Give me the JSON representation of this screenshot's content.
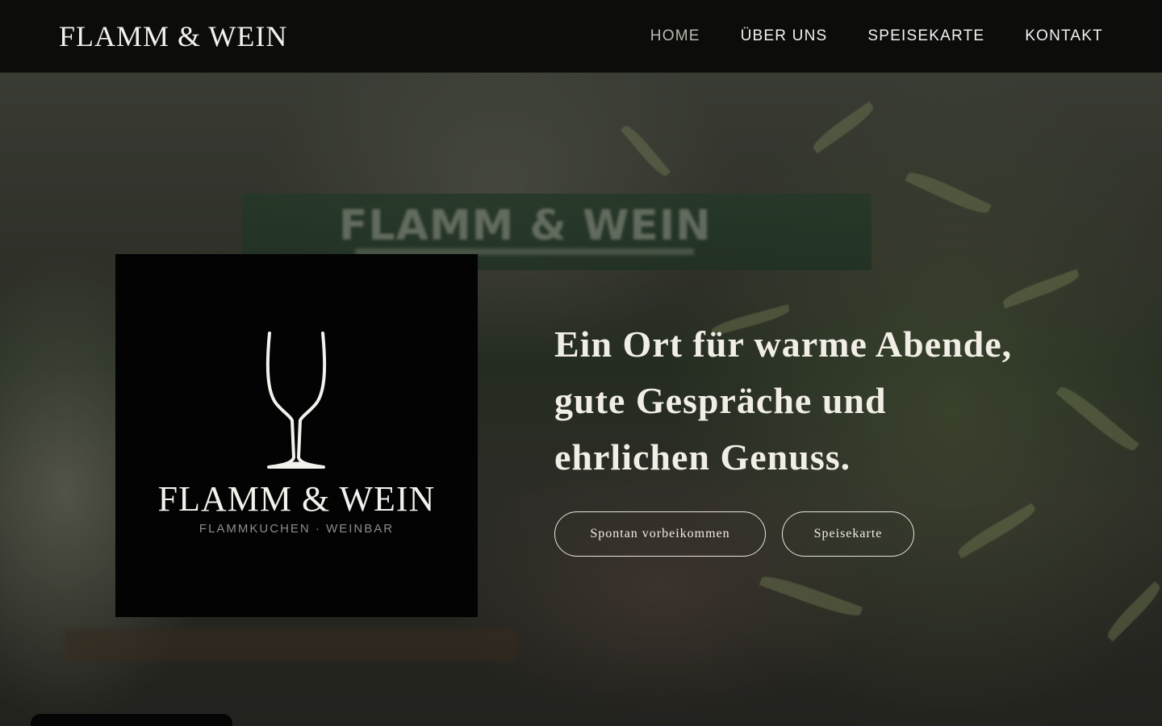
{
  "header": {
    "brand": "FLAMM & WEIN",
    "nav": [
      {
        "label": "HOME",
        "active": true
      },
      {
        "label": "ÜBER UNS",
        "active": false
      },
      {
        "label": "SPEISEKARTE",
        "active": false
      },
      {
        "label": "KONTAKT",
        "active": false
      }
    ]
  },
  "hero": {
    "background_sign_text": "FLAMM & WEIN",
    "logo": {
      "icon": "wine-glass-icon",
      "name": "FLAMM & WEIN",
      "subtitle": "FLAMMKUCHEN · WEINBAR"
    },
    "tagline_lines": [
      "Ein Ort für warme Abende,",
      "gute Gespräche und",
      "ehrlichen Genuss."
    ],
    "buttons": [
      {
        "label": "Spontan vorbeikommen"
      },
      {
        "label": "Speisekarte"
      }
    ]
  },
  "colors": {
    "header_bg": "#0c0c0b",
    "nav_active": "#b9b9b1",
    "text_light": "#f1eee6",
    "logo_bg": "#030303"
  }
}
